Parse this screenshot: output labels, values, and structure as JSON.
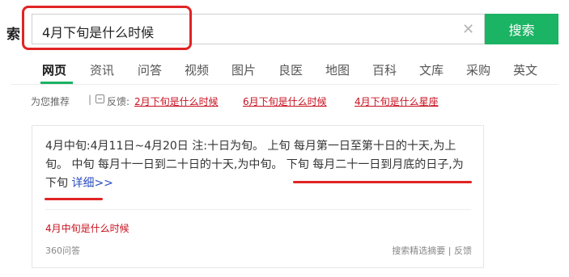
{
  "header": {
    "logo_fragment": "索",
    "search": {
      "query": "4月下旬是什么时候",
      "clear_icon": "close-icon"
    },
    "search_button": "搜索",
    "colors": {
      "brand": "#1bb364",
      "annotation": "#e02424"
    }
  },
  "tabs": [
    {
      "label": "网页",
      "active": true
    },
    {
      "label": "资讯"
    },
    {
      "label": "问答"
    },
    {
      "label": "视频"
    },
    {
      "label": "图片"
    },
    {
      "label": "良医"
    },
    {
      "label": "地图"
    },
    {
      "label": "百科"
    },
    {
      "label": "文库"
    },
    {
      "label": "采购"
    },
    {
      "label": "英文"
    }
  ],
  "recommend": {
    "label": "为您推荐",
    "separator": "|",
    "feedback": "反馈:",
    "links": [
      "2月下旬是什么时候",
      "6月下旬是什么时候",
      "4月下旬是什么星座"
    ]
  },
  "answer": {
    "text": "4月中旬:4月11日~4月20日 注:十日为旬。 上旬 每月第一日至第十日的十天,为上旬。 中旬 每月十一日到二十日的十天,为中旬。 下旬 每月二十一日到月底的日子,为下旬 ",
    "detail_link": "详细>>",
    "related_question": "4月中旬是什么时候",
    "source": "360问答",
    "meta_left": "搜索精选摘要",
    "meta_sep": "|",
    "meta_right": "反馈"
  }
}
